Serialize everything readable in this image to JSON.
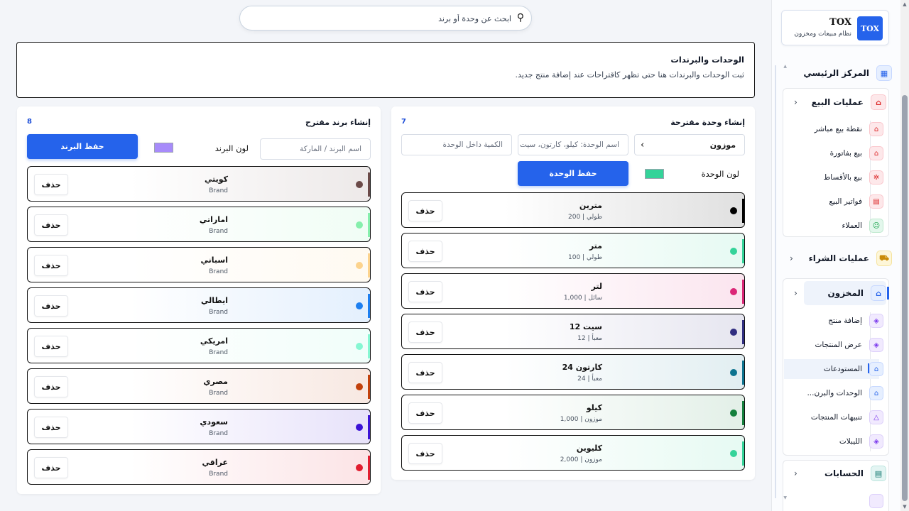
{
  "search": {
    "placeholder": "ابحث عن وحدة أو برند"
  },
  "header": {
    "title": "الوحدات والبرندات",
    "subtitle": "ثبت الوحدات والبرندات هنا حتى تظهر كاقتراحات عند إضافة منتج جديد."
  },
  "sidebar": {
    "brand_logo": "TOX",
    "brand_name": "TOX",
    "brand_sub": "نظام مبيعات ومخزون",
    "main_center": "المركز الرئيسي",
    "sales": {
      "label": "عمليات البيع",
      "items": [
        "نقطة بيع مباشر",
        "بيع بفاتورة",
        "بيع بالأقساط",
        "فواتير البيع",
        "العملاء"
      ]
    },
    "purchases": {
      "label": "عمليات الشراء"
    },
    "inventory": {
      "label": "المخزون",
      "items": [
        "إضافة منتج",
        "عرض المنتجات",
        "المستودعات",
        "الوحدات والبرن...",
        "تنبيهات المنتجات",
        "الليبلات"
      ]
    },
    "accounts": {
      "label": "الحسابات"
    }
  },
  "units_panel": {
    "title": "إنشاء وحدة مقترحة",
    "count": "7",
    "type_select": "موزون",
    "name_placeholder": "اسم الوحدة: كيلو، كارتون، سيت",
    "qty_placeholder": "الكمية داخل الوحدة",
    "color_label": "لون الوحدة",
    "color": "#34d399",
    "save_label": "حفظ الوحدة",
    "delete_label": "حذف",
    "rows": [
      {
        "name": "مترين",
        "sub": "طولي | 200",
        "color": "#000000"
      },
      {
        "name": "متر",
        "sub": "طولي | 100",
        "color": "#34d399"
      },
      {
        "name": "لتر",
        "sub": "سائل | 1,000",
        "color": "#db2777"
      },
      {
        "name": "سيت 12",
        "sub": "معبأ | 12",
        "color": "#312e81"
      },
      {
        "name": "كارتون 24",
        "sub": "معبأ | 24",
        "color": "#0e7490"
      },
      {
        "name": "كيلو",
        "sub": "موزون | 1,000",
        "color": "#15803d"
      },
      {
        "name": "كليوين",
        "sub": "موزون | 2,000",
        "color": "#34d399"
      }
    ]
  },
  "brands_panel": {
    "title": "إنشاء برند مقترح",
    "count": "8",
    "name_placeholder": "اسم البرند / الماركة",
    "color_label": "لون البرند",
    "color": "#a78bfa",
    "save_label": "حفظ البرند",
    "delete_label": "حذف",
    "rows": [
      {
        "name": "كويتي",
        "sub": "Brand",
        "color": "#6b4a48"
      },
      {
        "name": "اماراتي",
        "sub": "Brand",
        "color": "#86efac"
      },
      {
        "name": "اسباني",
        "sub": "Brand",
        "color": "#fcd38d"
      },
      {
        "name": "ايطالي",
        "sub": "Brand",
        "color": "#1d7ff0"
      },
      {
        "name": "امريكي",
        "sub": "Brand",
        "color": "#86f7d2"
      },
      {
        "name": "مصري",
        "sub": "Brand",
        "color": "#c2410c"
      },
      {
        "name": "سعودي",
        "sub": "Brand",
        "color": "#3b12d6"
      },
      {
        "name": "عراقي",
        "sub": "Brand",
        "color": "#e11d2f"
      }
    ]
  }
}
